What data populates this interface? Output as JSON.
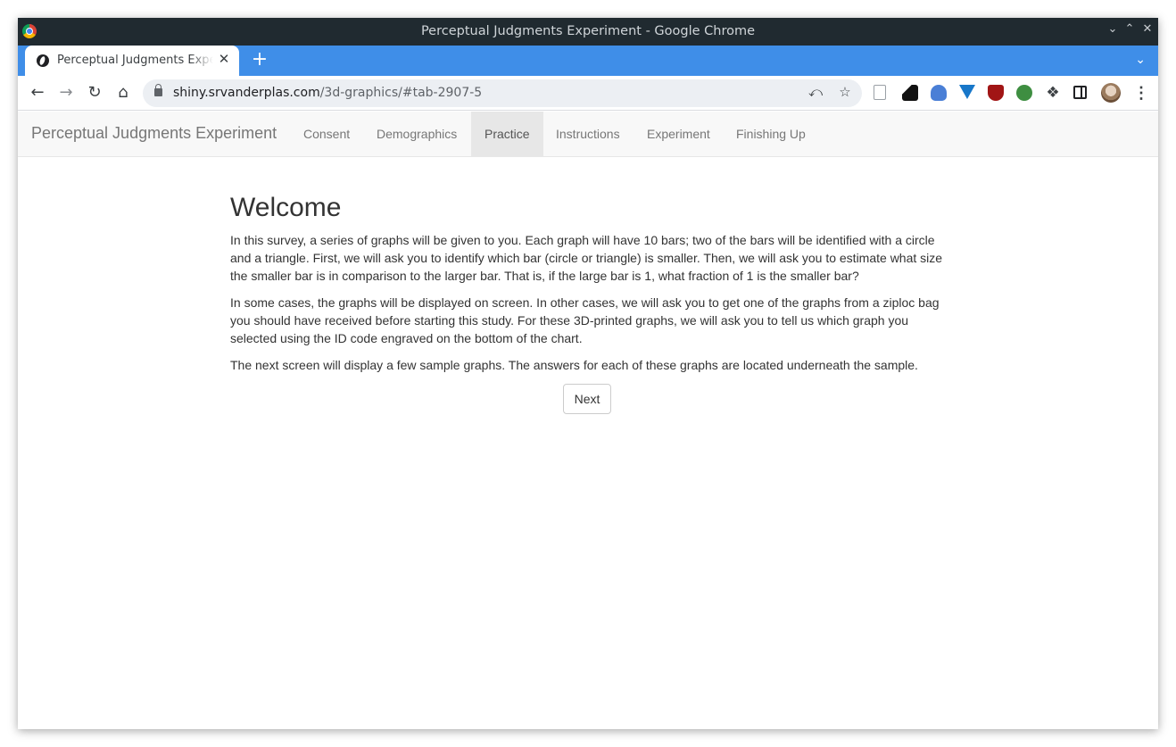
{
  "window": {
    "title": "Perceptual Judgments Experiment - Google Chrome"
  },
  "tab": {
    "title": "Perceptual Judgments Experiment",
    "close_glyph": "✕",
    "new_tab_glyph": "+"
  },
  "toolbar": {
    "url_host": "shiny.srvanderplas.com",
    "url_path": "/3d-graphics/#tab-2907-5"
  },
  "navbar": {
    "brand": "Perceptual Judgments Experiment",
    "items": [
      {
        "label": "Consent",
        "active": false
      },
      {
        "label": "Demographics",
        "active": false
      },
      {
        "label": "Practice",
        "active": true
      },
      {
        "label": "Instructions",
        "active": false
      },
      {
        "label": "Experiment",
        "active": false
      },
      {
        "label": "Finishing Up",
        "active": false
      }
    ]
  },
  "main": {
    "heading": "Welcome",
    "paragraphs": [
      "In this survey, a series of graphs will be given to you. Each graph will have 10 bars; two of the bars will be identified with a circle and a triangle. First, we will ask you to identify which bar (circle or triangle) is smaller. Then, we will ask you to estimate what size the smaller bar is in comparison to the larger bar. That is, if the large bar is 1, what fraction of 1 is the smaller bar?",
      "In some cases, the graphs will be displayed on screen. In other cases, we will ask you to get one of the graphs from a ziploc bag you should have received before starting this study. For these 3D-printed graphs, we will ask you to tell us which graph you selected using the ID code engraved on the bottom of the chart.",
      "The next screen will display a few sample graphs. The answers for each of these graphs are located underneath the sample."
    ],
    "next_button": "Next"
  },
  "colors": {
    "titlebar": "#202a30",
    "tabstrip": "#3f8ee8",
    "navbar_bg": "#f8f8f8",
    "navbar_active": "#e7e7e7"
  }
}
